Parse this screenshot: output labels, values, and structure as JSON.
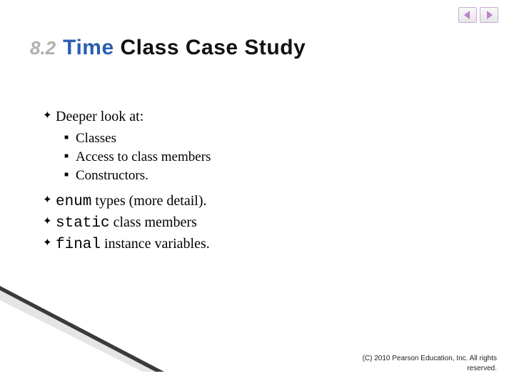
{
  "section": {
    "number": "8.2",
    "title_part1": "Time",
    "title_part2": "Class Case Study"
  },
  "bullets": {
    "b0": {
      "text": "Deeper look at:",
      "sub": [
        "Classes",
        "Access to class members",
        "Constructors."
      ]
    },
    "b1": {
      "code": "enum",
      "rest": " types (more detail)."
    },
    "b2": {
      "code": "static",
      "rest": " class members"
    },
    "b3": {
      "code": "final",
      "rest": " instance variables."
    }
  },
  "copyright": "(C) 2010 Pearson Education, Inc. All rights reserved.",
  "colors": {
    "accent_blue": "#2a5db0",
    "section_number_gray": "#b0b0b0",
    "nav_border": "#c9a9d6"
  }
}
